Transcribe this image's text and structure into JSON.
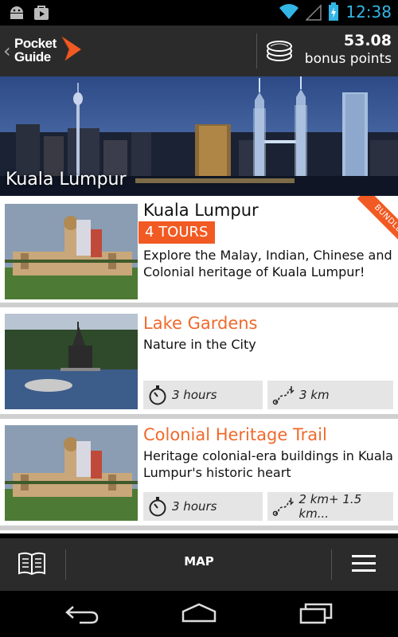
{
  "status_bar": {
    "time": "12:38"
  },
  "header": {
    "logo_line1": "Pocket",
    "logo_line2": "Guide",
    "points_value": "53.08",
    "points_label": "bonus points"
  },
  "hero": {
    "title": "Kuala Lumpur"
  },
  "cards": [
    {
      "title": "Kuala Lumpur",
      "badge": "4 TOURS",
      "ribbon": "BUNDLE",
      "description": "Explore the Malay, Indian, Chinese and Colonial heritage of Kuala Lumpur!"
    },
    {
      "title": "Lake Gardens",
      "description": "Nature in the City",
      "duration": "3 hours",
      "distance": "3 km"
    },
    {
      "title": "Colonial Heritage Trail",
      "description": "Heritage colonial-era buildings in Kuala Lumpur's historic heart",
      "duration": "3 hours",
      "distance": "2 km+ 1.5 km..."
    }
  ],
  "bottom_bar": {
    "map_label": "MAP"
  },
  "colors": {
    "accent": "#f15a22",
    "title_orange": "#ef6a2c",
    "bar_bg": "#2b2b2b",
    "clock": "#33b5e5"
  }
}
